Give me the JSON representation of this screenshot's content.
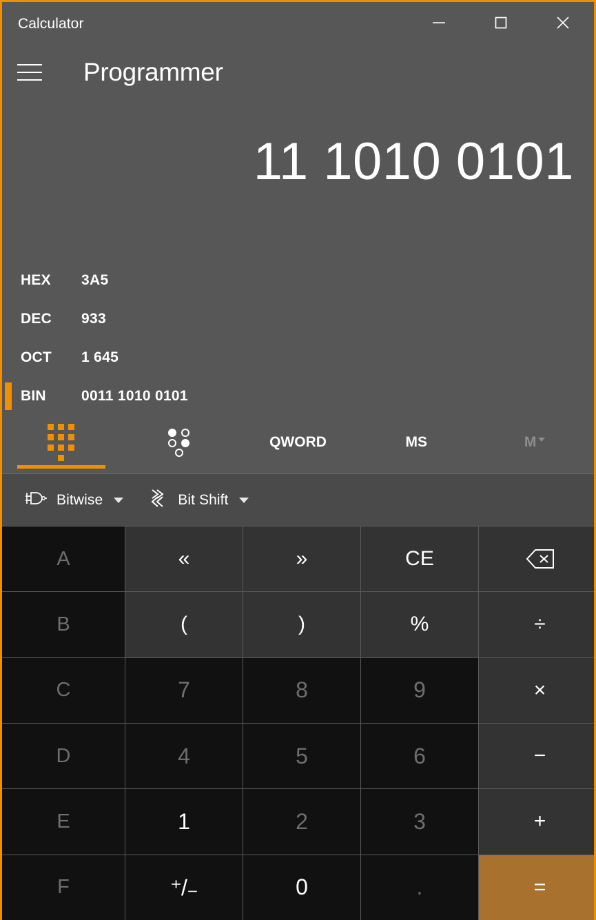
{
  "window": {
    "app_title": "Calculator",
    "accent_color": "#f09000",
    "controls": [
      {
        "name": "minimize",
        "glyph": "minimize-icon"
      },
      {
        "name": "maximize",
        "glyph": "maximize-icon"
      },
      {
        "name": "close",
        "glyph": "close-icon"
      }
    ]
  },
  "header": {
    "menu_icon": "hamburger-menu-icon",
    "mode_title": "Programmer"
  },
  "display": {
    "main_value": "11 1010 0101",
    "radix_rows": [
      {
        "label": "HEX",
        "value": "3A5",
        "selected": false
      },
      {
        "label": "DEC",
        "value": "933",
        "selected": false
      },
      {
        "label": "OCT",
        "value": "1 645",
        "selected": false
      },
      {
        "label": "BIN",
        "value": "0011 1010 0101",
        "selected": true
      }
    ]
  },
  "tabs": [
    {
      "id": "keypad",
      "label": "",
      "icon": "keypad-icon",
      "active": true,
      "disabled": false
    },
    {
      "id": "bit-toggle",
      "label": "",
      "icon": "bit-toggle-icon",
      "active": false,
      "disabled": false
    },
    {
      "id": "wordsize",
      "label": "QWORD",
      "icon": "",
      "active": false,
      "disabled": false
    },
    {
      "id": "memory-store",
      "label": "MS",
      "icon": "",
      "active": false,
      "disabled": false
    },
    {
      "id": "memory-menu",
      "label": "M",
      "icon": "caret-down-icon",
      "active": false,
      "disabled": true
    }
  ],
  "bitwise_bar": [
    {
      "id": "bitwise",
      "label": "Bitwise",
      "icon": "logic-gate-icon",
      "caret": "chevron-down-icon"
    },
    {
      "id": "bit-shift",
      "label": "Bit Shift",
      "icon": "bit-shift-icon",
      "caret": "chevron-down-icon"
    }
  ],
  "keypad": {
    "rows": [
      [
        {
          "id": "hex-a",
          "label": "A",
          "type": "hex"
        },
        {
          "id": "shift-left",
          "label": "«",
          "type": "op"
        },
        {
          "id": "shift-right",
          "label": "»",
          "type": "op"
        },
        {
          "id": "clear-entry",
          "label": "CE",
          "type": "op"
        },
        {
          "id": "backspace",
          "label": "",
          "type": "op",
          "icon": "backspace-icon"
        }
      ],
      [
        {
          "id": "hex-b",
          "label": "B",
          "type": "hex"
        },
        {
          "id": "paren-open",
          "label": "(",
          "type": "op"
        },
        {
          "id": "paren-close",
          "label": ")",
          "type": "op"
        },
        {
          "id": "percent",
          "label": "%",
          "type": "op"
        },
        {
          "id": "divide",
          "label": "÷",
          "type": "op"
        }
      ],
      [
        {
          "id": "hex-c",
          "label": "C",
          "type": "hex"
        },
        {
          "id": "seven",
          "label": "7",
          "type": "digit-dim"
        },
        {
          "id": "eight",
          "label": "8",
          "type": "digit-dim"
        },
        {
          "id": "nine",
          "label": "9",
          "type": "digit-dim"
        },
        {
          "id": "multiply",
          "label": "×",
          "type": "op"
        }
      ],
      [
        {
          "id": "hex-d",
          "label": "D",
          "type": "hex"
        },
        {
          "id": "four",
          "label": "4",
          "type": "digit-dim"
        },
        {
          "id": "five",
          "label": "5",
          "type": "digit-dim"
        },
        {
          "id": "six",
          "label": "6",
          "type": "digit-dim"
        },
        {
          "id": "subtract",
          "label": "−",
          "type": "op"
        }
      ],
      [
        {
          "id": "hex-e",
          "label": "E",
          "type": "hex"
        },
        {
          "id": "one",
          "label": "1",
          "type": "digit"
        },
        {
          "id": "two",
          "label": "2",
          "type": "digit-dim"
        },
        {
          "id": "three",
          "label": "3",
          "type": "digit-dim"
        },
        {
          "id": "add",
          "label": "+",
          "type": "op"
        }
      ],
      [
        {
          "id": "hex-f",
          "label": "F",
          "type": "hex"
        },
        {
          "id": "plus-minus",
          "label": "⁺/₋",
          "type": "digit"
        },
        {
          "id": "zero",
          "label": "0",
          "type": "digit"
        },
        {
          "id": "decimal",
          "label": ".",
          "type": "digit-dim"
        },
        {
          "id": "equals",
          "label": "=",
          "type": "equals"
        }
      ]
    ]
  }
}
